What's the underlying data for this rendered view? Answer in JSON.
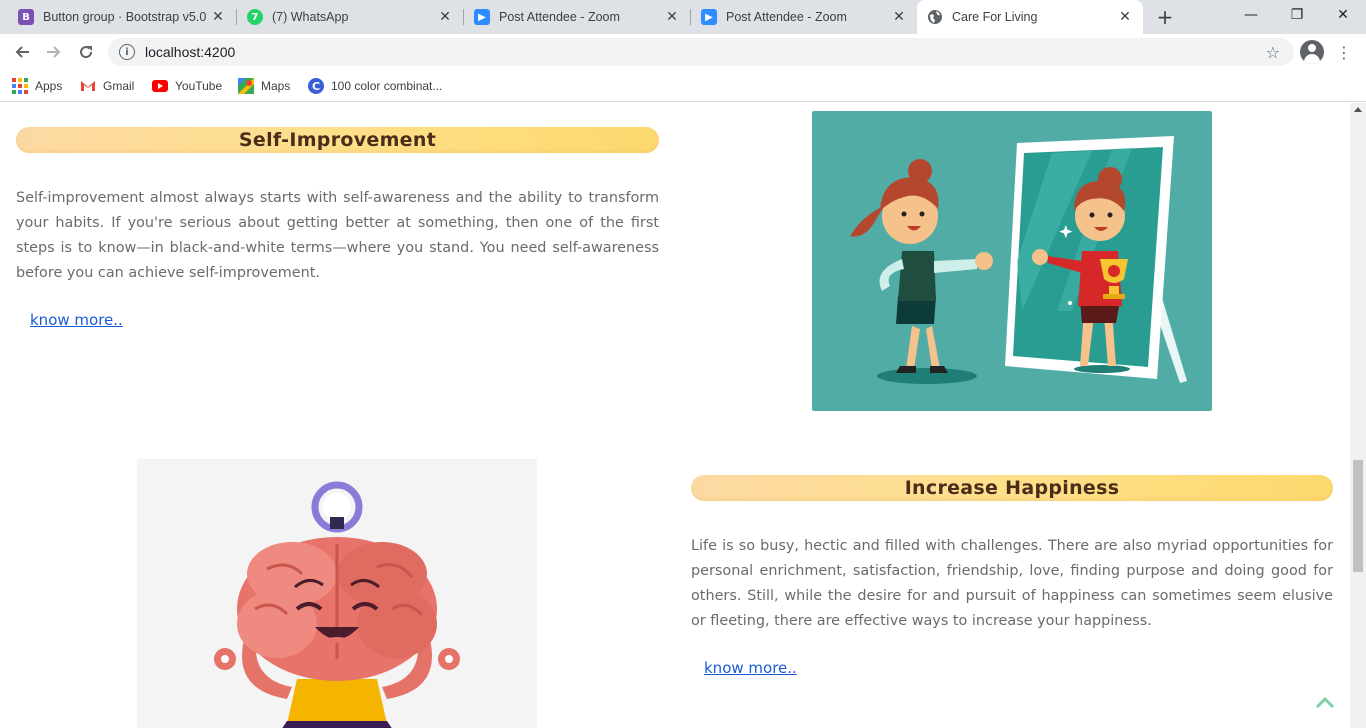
{
  "browser": {
    "tabs": [
      {
        "title": "Button group · Bootstrap v5.0",
        "icon": "bootstrap-icon",
        "active": false
      },
      {
        "title": "(7) WhatsApp",
        "icon": "whatsapp-icon",
        "active": false
      },
      {
        "title": "Post Attendee - Zoom",
        "icon": "zoom-icon",
        "active": false
      },
      {
        "title": "Post Attendee - Zoom",
        "icon": "zoom-icon",
        "active": false
      },
      {
        "title": "Care For Living",
        "icon": "globe-icon",
        "active": true
      }
    ],
    "new_tab_label": "+",
    "url": "localhost:4200",
    "bookmarks": [
      {
        "label": "Apps",
        "icon": "apps-grid-icon"
      },
      {
        "label": "Gmail",
        "icon": "gmail-icon"
      },
      {
        "label": "YouTube",
        "icon": "youtube-icon"
      },
      {
        "label": "Maps",
        "icon": "maps-icon"
      },
      {
        "label": "100 color combinat...",
        "icon": "canva-icon"
      }
    ]
  },
  "sections": [
    {
      "heading": "Self-Improvement",
      "text": "Self-improvement almost always starts with self-awareness and the ability to transform your habits. If you're serious about getting better at something, then one of the first steps is to know—in black-and-white terms—where you stand. You need self-awareness before you can achieve self-improvement.",
      "link": "know more.."
    },
    {
      "heading": "Increase Happiness",
      "text": "Life is so busy, hectic and filled with challenges. There are also myriad opportunities for personal enrichment, satisfaction, friendship, love, finding purpose and doing good for others. Still, while the desire for and pursuit of happiness can sometimes seem elusive or fleeting, there are effective ways to increase your happiness.",
      "link": "know more.."
    }
  ],
  "colors": {
    "accent_link": "#1a5bd6",
    "heading_pill": "#ffe08a",
    "illustration_bg": "#52aca6"
  }
}
